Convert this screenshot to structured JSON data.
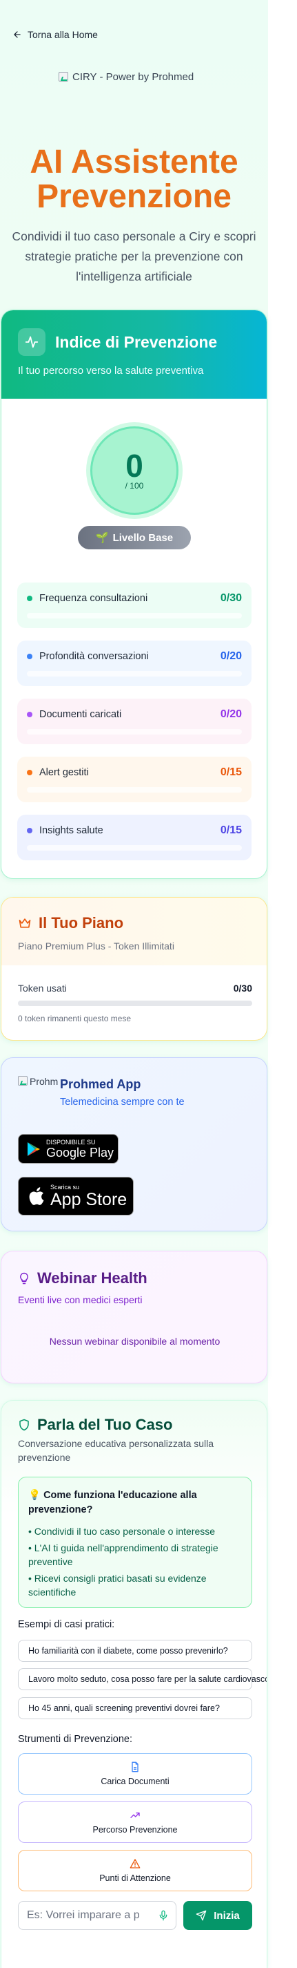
{
  "nav": {
    "back_label": "Torna alla Home"
  },
  "logo": {
    "alt_text": "CIRY - Power by Prohmed"
  },
  "hero": {
    "title": "AI Assistente Prevenzione",
    "subtitle": "Condividi il tuo caso personale a Ciry e scopri strategie pratiche per la prevenzione con l'intelligenza artificiale"
  },
  "indice": {
    "title": "Indice di Prevenzione",
    "subtitle": "Il tuo percorso verso la salute preventiva",
    "score": "0",
    "score_max": "/ 100",
    "level_icon": "🌱",
    "level_label": "Livello Base",
    "metrics": [
      {
        "label": "Frequenza consultazioni",
        "value": "0/30",
        "fraction": 0,
        "color": "#10b981",
        "value_color": "#059669",
        "bg": "#ecfdf5"
      },
      {
        "label": "Profondità conversazioni",
        "value": "0/20",
        "fraction": 0,
        "color": "#3b82f6",
        "value_color": "#2563eb",
        "bg": "#eff6ff"
      },
      {
        "label": "Documenti caricati",
        "value": "0/20",
        "fraction": 0,
        "color": "#a855f7",
        "value_color": "#9333ea",
        "bg": "#fdf2f8"
      },
      {
        "label": "Alert gestiti",
        "value": "0/15",
        "fraction": 0,
        "color": "#f97316",
        "value_color": "#ea580c",
        "bg": "#fff7ed"
      },
      {
        "label": "Insights salute",
        "value": "0/15",
        "fraction": 0,
        "color": "#6366f1",
        "value_color": "#4f46e5",
        "bg": "#eef2ff"
      }
    ]
  },
  "piano": {
    "title": "Il Tuo Piano",
    "subtitle": "Piano Premium Plus - Token Illimitati",
    "tokens_label": "Token usati",
    "tokens_value": "0/30",
    "tokens_fraction": 0,
    "tokens_note": "0 token rimanenti questo mese"
  },
  "app": {
    "logo_alt": "Prohm",
    "title": "Prohmed App",
    "subtitle": "Telemedicina sempre con te",
    "google_small": "DISPONIBILE SU",
    "google_big": "Google Play",
    "apple_small": "Scarica su",
    "apple_big": "App Store"
  },
  "webinar": {
    "title": "Webinar Health",
    "subtitle": "Eventi live con medici esperti",
    "empty": "Nessun webinar disponibile al momento"
  },
  "parla": {
    "title": "Parla del Tuo Caso",
    "subtitle": "Conversazione educativa personalizzata sulla prevenzione",
    "how_title": "💡 Come funziona l'educazione alla prevenzione?",
    "how_items": [
      "• Condividi il tuo caso personale o interesse",
      "• L'AI ti guida nell'apprendimento di strategie preventive",
      "• Ricevi consigli pratici basati su evidenze scientifiche"
    ],
    "examples_label": "Esempi di casi pratici:",
    "examples": [
      "Ho familiarità con il diabete, come posso prevenirlo?",
      "Lavoro molto seduto, cosa posso fare per la salute cardiovascolare?",
      "Ho 45 anni, quali screening preventivi dovrei fare?"
    ],
    "tools_label": "Strumenti di Prevenzione:",
    "tools": [
      {
        "label": "Carica Documenti",
        "icon": "document-icon",
        "color": "#3b82f6",
        "border": "#93c5fd"
      },
      {
        "label": "Percorso Prevenzione",
        "icon": "trending-up-icon",
        "color": "#9333ea",
        "border": "#c4b5fd"
      },
      {
        "label": "Punti di Attenzione",
        "icon": "alert-triangle-icon",
        "color": "#ea580c",
        "border": "#fdba74"
      }
    ],
    "input_placeholder": "Es: Vorrei imparare a p",
    "start_label": "Inizia"
  }
}
